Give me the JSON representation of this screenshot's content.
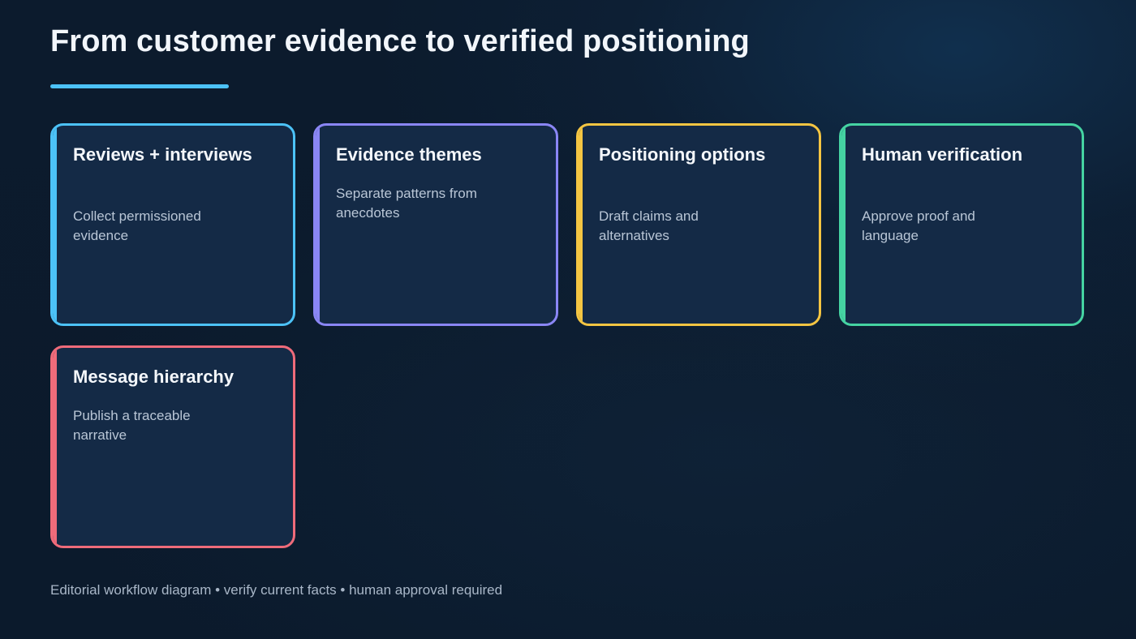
{
  "title": "From customer evidence to verified positioning",
  "cards": [
    {
      "title": "Reviews + interviews",
      "description": "Collect permissioned evidence",
      "accent": "#4cc2f7"
    },
    {
      "title": "Evidence themes",
      "description": "Separate patterns from anecdotes",
      "accent": "#8a86f5"
    },
    {
      "title": "Positioning options",
      "description": "Draft claims and alternatives",
      "accent": "#f4c542"
    },
    {
      "title": "Human verification",
      "description": "Approve proof and language",
      "accent": "#45d3a2"
    },
    {
      "title": "Message hierarchy",
      "description": "Publish a traceable narrative",
      "accent": "#ef6b7a"
    }
  ],
  "footer": "Editorial workflow diagram • verify current facts • human approval required"
}
